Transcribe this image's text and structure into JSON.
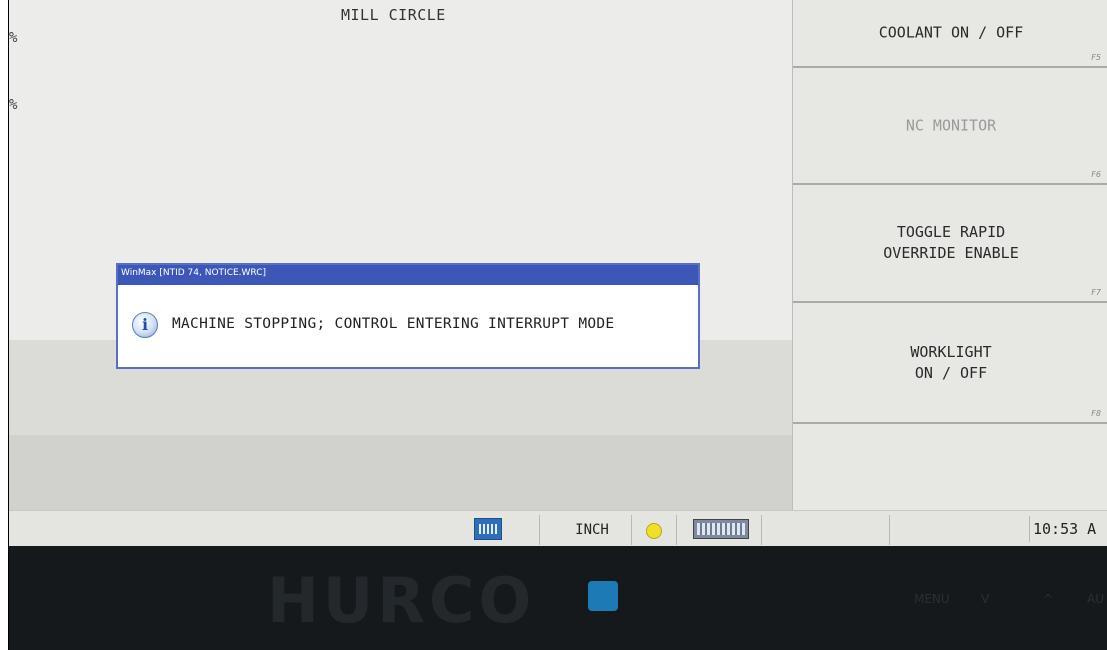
{
  "screen": {
    "title": "MILL CIRCLE",
    "side_marks": [
      "%",
      "%"
    ]
  },
  "function_keys": [
    {
      "label": "COOLANT ON / OFF",
      "code": "F5",
      "enabled": true
    },
    {
      "label": "NC MONITOR",
      "code": "F6",
      "enabled": false
    },
    {
      "label": "TOGGLE RAPID\nOVERRIDE ENABLE",
      "code": "F7",
      "enabled": true
    },
    {
      "label": "WORKLIGHT\nON / OFF",
      "code": "F8",
      "enabled": true
    }
  ],
  "dialog": {
    "title": "WinMax [NTID 74, NOTICE.WRC]",
    "icon": "info-icon",
    "message": "MACHINE STOPPING; CONTROL ENTERING INTERRUPT MODE"
  },
  "taskbar": {
    "units": "INCH",
    "time": "10:53 A",
    "status_color": "#f1e02a"
  },
  "bezel": {
    "logo": "HURCO",
    "buttons": [
      "MENU",
      "V",
      "^",
      "AU"
    ]
  }
}
